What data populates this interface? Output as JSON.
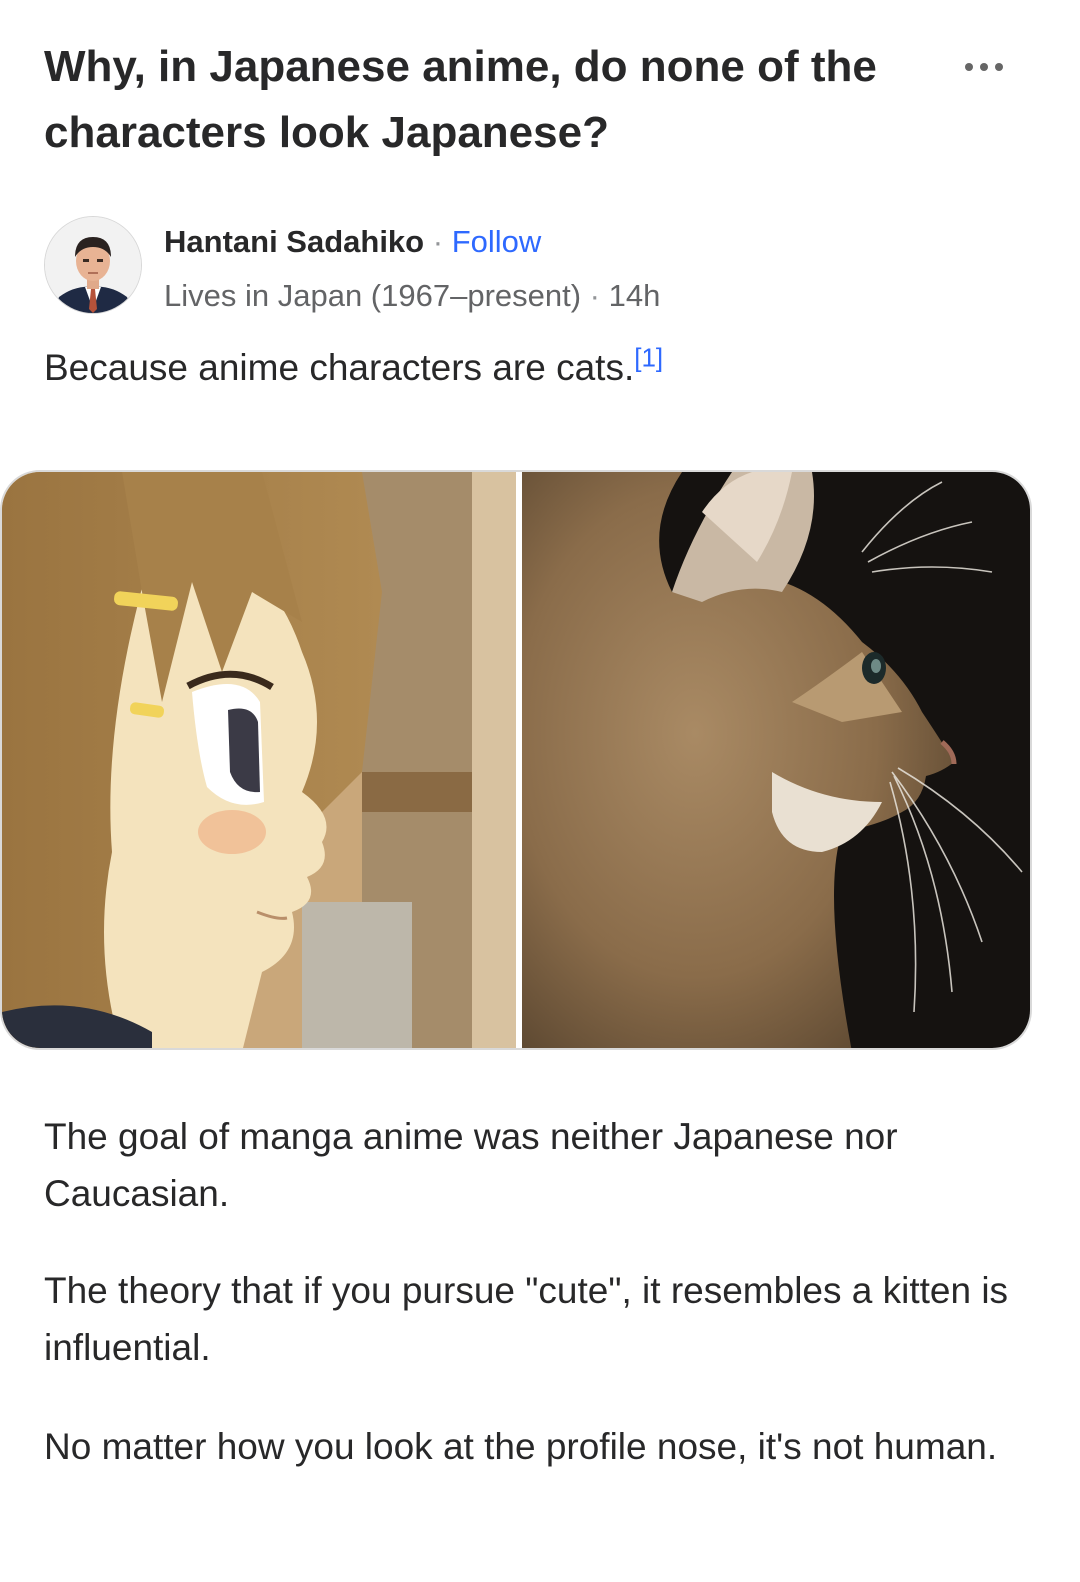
{
  "question": {
    "title": "Why, in Japanese anime, do none of the characters look Japanese?",
    "more_icon": "more-horizontal-icon"
  },
  "author": {
    "name": "Hantani Sadahiko",
    "separator": "·",
    "follow_label": "Follow",
    "credential": "Lives in Japan (1967–present)",
    "time_ago": "14h"
  },
  "answer": {
    "intro": "Because anime characters are cats.",
    "footnote": "[1]",
    "paragraphs": [
      "The goal of manga anime was neither Japanese nor Caucasian.",
      "The theory that if you pursue \"cute\", it resembles a kitten is influential.",
      "No matter how you look at the profile nose, it's not human."
    ]
  },
  "colors": {
    "text": "#282829",
    "secondary_text": "#636466",
    "link": "#2e69ff"
  }
}
